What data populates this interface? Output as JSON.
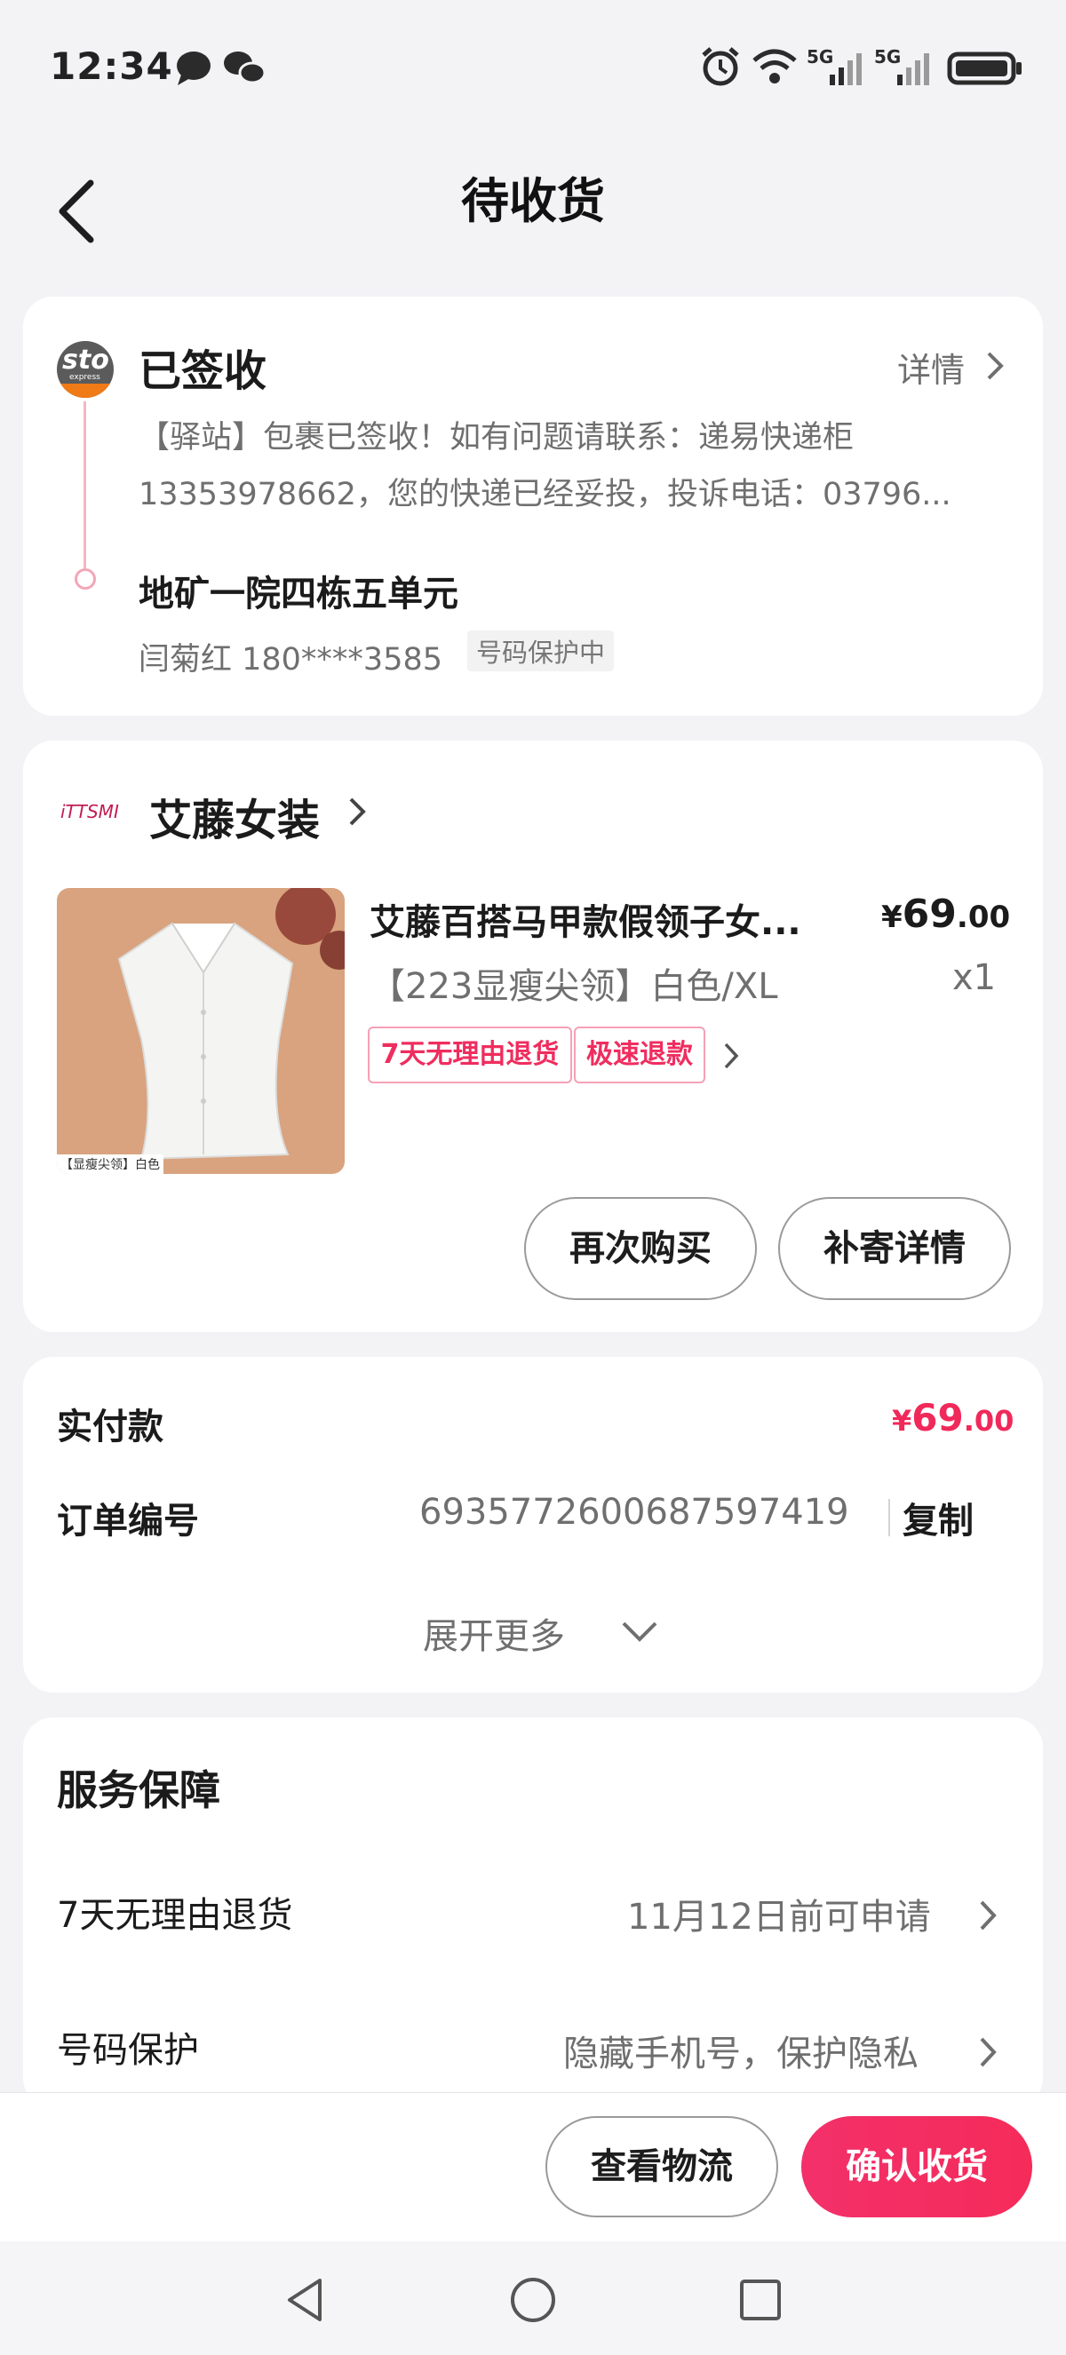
{
  "status_bar": {
    "time": "12:34",
    "signal_1": "5G",
    "signal_2": "5G"
  },
  "header": {
    "title": "待收货"
  },
  "logistics": {
    "carrier_logo": "sto",
    "carrier_logo_sub": "express",
    "status": "已签收",
    "details_label": "详情",
    "message_line1": "【驿站】包裹已签收！如有问题请联系：递易快递柜",
    "message_line2": "13353978662，您的快递已经妥投，投诉电话：03796...",
    "address": "地矿一院四栋五单元",
    "recipient": "闫菊红 180****3585",
    "privacy_badge": "号码保护中"
  },
  "store": {
    "logo_text": "iTTSMI",
    "name": "艾藤女装",
    "product": {
      "title": "艾藤百搭马甲款假领子女...",
      "variant": "【223显瘦尖领】白色/XL",
      "price_symbol": "¥",
      "price_int": "69",
      "price_dec": ".00",
      "quantity": "x1",
      "tags": [
        "7天无理由退货",
        "极速退款"
      ],
      "image_caption": "【显瘦尖领】白色"
    },
    "buy_again_label": "再次购买",
    "reship_label": "补寄详情"
  },
  "payment": {
    "paid_label": "实付款",
    "paid_symbol": "¥",
    "paid_int": "69",
    "paid_dec": ".00",
    "order_label": "订单编号",
    "order_number": "6935772600687597419",
    "copy_label": "复制",
    "expand_label": "展开更多"
  },
  "services": {
    "title": "服务保障",
    "rows": [
      {
        "label": "7天无理由退货",
        "value": "11月12日前可申请"
      },
      {
        "label": "号码保护",
        "value": "隐藏手机号，保护隐私"
      }
    ]
  },
  "actions": {
    "track_label": "查看物流",
    "confirm_label": "确认收货"
  },
  "colors": {
    "accent": "#f0295a",
    "background": "#f3f3f6",
    "card": "#ffffff"
  },
  "icons": [
    "message-icon",
    "wechat-icon",
    "alarm-icon",
    "wifi-icon",
    "signal-icon",
    "battery-icon",
    "back-arrow-icon",
    "chevron-right-icon",
    "chevron-down-icon",
    "nav-back-icon",
    "nav-home-icon",
    "nav-recent-icon"
  ]
}
